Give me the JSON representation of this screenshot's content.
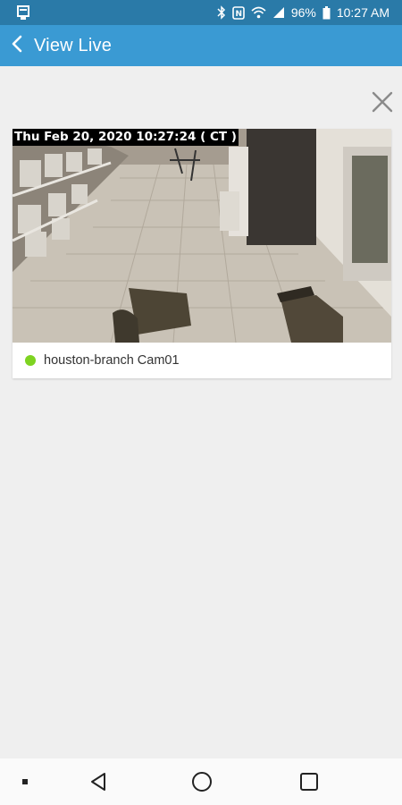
{
  "status_bar": {
    "battery": "96%",
    "time": "10:27 AM",
    "icons": [
      "notification-icon",
      "bluetooth-icon",
      "nfc-icon",
      "wifi-icon",
      "signal-icon",
      "battery-icon"
    ]
  },
  "app_bar": {
    "title": "View Live",
    "back_icon": "chevron-left-icon",
    "background": "#3a9ad3"
  },
  "viewer": {
    "close_icon": "close-icon",
    "camera": {
      "timestamp": "Thu Feb 20, 2020 10:27:24 ( CT )",
      "name": "houston-branch Cam01",
      "status_color": "#7ed321"
    }
  },
  "nav_bar": {
    "items": [
      "recent-dot-icon",
      "back-triangle-icon",
      "home-circle-icon",
      "overview-square-icon"
    ]
  }
}
